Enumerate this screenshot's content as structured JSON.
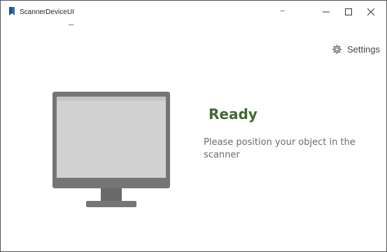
{
  "window": {
    "title": "ScannerDeviceUI",
    "grip_glyph": "↔",
    "controls": {
      "minimize_icon": "minimize-icon",
      "maximize_icon": "maximize-icon",
      "close_icon": "close-icon"
    }
  },
  "header": {
    "settings_label": "Settings",
    "settings_icon": "gear-icon"
  },
  "status": {
    "title": "Ready",
    "description": "Please position your object in the scanner",
    "title_color": "#3e6b32",
    "illustration": "monitor-icon"
  },
  "colors": {
    "app_icon": "#2f6db4",
    "text_muted": "#6b6b6b"
  }
}
